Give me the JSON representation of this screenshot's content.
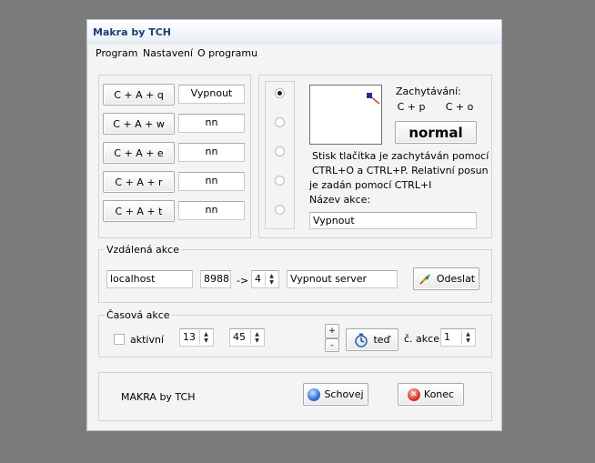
{
  "window": {
    "title": "Makra by TCH"
  },
  "menu": {
    "items": [
      "Program",
      "Nastavení",
      "O programu"
    ]
  },
  "macros": {
    "rows": [
      {
        "key": "C + A + q",
        "value": "Vypnout"
      },
      {
        "key": "C + A + w",
        "value": "nn"
      },
      {
        "key": "C + A + e",
        "value": "nn"
      },
      {
        "key": "C + A + r",
        "value": "nn"
      },
      {
        "key": "C + A + t",
        "value": "nn"
      }
    ]
  },
  "capture": {
    "label": "Zachytávání:",
    "btn_p": "C + p",
    "btn_o": "C + o",
    "mode": "normal",
    "help": [
      "Stisk tlačítka je zachytáván pomocí",
      "CTRL+O a CTRL+P. Relativní posun",
      "je zadán pomocí CTRL+I"
    ],
    "action_name_label": "Název akce:",
    "action_name_value": "Vypnout"
  },
  "remote": {
    "caption": "Vzdálená akce",
    "host": "localhost",
    "port": "8988",
    "arrow": "->",
    "number": "4",
    "action": "Vypnout server",
    "send_label": "Odeslat"
  },
  "timed": {
    "caption": "Časová akce",
    "active_label": "aktivní",
    "active_checked": false,
    "hour": "13",
    "minute": "45",
    "plus": "+",
    "minus": "-",
    "now_label": "teď",
    "action_no_label": "č. akce",
    "action_no": "1"
  },
  "footer": {
    "brand": "MAKRA by TCH",
    "hide_label": "Schovej",
    "exit_label": "Konec"
  },
  "colors": {
    "title_text": "#1c3f75",
    "hide_icon": "#2e6fd4",
    "exit_icon": "#d6362c"
  }
}
